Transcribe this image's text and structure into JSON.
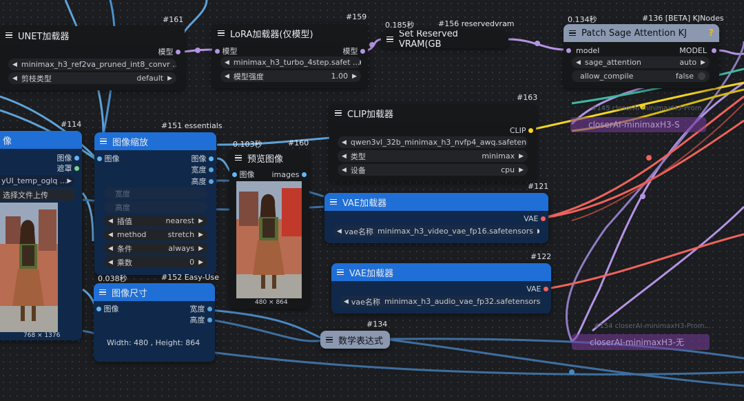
{
  "nodes": {
    "unet": {
      "id": "#161",
      "title": "UNET加载器",
      "out": "模型",
      "w1_value": "minimax_h3_ref2va_pruned_int8_convr ...",
      "w2_label": "剪枝类型",
      "w2_value": "default"
    },
    "lora": {
      "id": "#159",
      "title": "LoRA加载器(仅模型)",
      "in": "模型",
      "out": "模型",
      "w1_value": "minimax_h3_turbo_4step.safet ...",
      "w2_label": "模型强度",
      "w2_value": "1.00"
    },
    "vram": {
      "id": "#156 reservedvram",
      "time": "0.185秒",
      "title": "Set Reserved VRAM(GB"
    },
    "sage": {
      "id": "#136 [BETA] KJNodes",
      "time": "0.134秒",
      "title": "Patch Sage Attention KJ",
      "help": "?",
      "in": "model",
      "out": "MODEL",
      "w1_label": "sage_attention",
      "w1_value": "auto",
      "w2_label": "allow_compile",
      "w2_value": "false"
    },
    "clip": {
      "id": "#163",
      "title": "CLIP加载器",
      "out": "CLIP",
      "w1_value": "qwen3vl_32b_minimax_h3_nvfp4_awq.safeten ...",
      "w2_label": "类型",
      "w2_value": "minimax",
      "w3_label": "设备",
      "w3_value": "cpu"
    },
    "loadimg": {
      "id": "#114",
      "title": "像",
      "out1": "图像",
      "out2": "遮罩",
      "w1_value": "yUI_temp_oglq ...",
      "upload": "选择文件上传",
      "dims": "768 × 1376"
    },
    "scale": {
      "id": "#151 essentials",
      "title": "图像缩放",
      "in": "图像",
      "out1": "图像",
      "out2": "宽度",
      "out3": "高度",
      "p1": "宽度",
      "p2": "高度",
      "w1_label": "插值",
      "w1_value": "nearest",
      "w2_label": "method",
      "w2_value": "stretch",
      "w3_label": "条件",
      "w3_value": "always",
      "w4_label": "乘数",
      "w4_value": "0"
    },
    "preview": {
      "id": "#160",
      "time": "0.103秒",
      "title": "预览图像",
      "in": "图像",
      "out": "images",
      "dims": "480 × 864"
    },
    "vae1": {
      "id": "#121",
      "title": "VAE加载器",
      "out": "VAE",
      "w_label": "vae名称",
      "w_value": "minimax_h3_video_vae_fp16.safetensors"
    },
    "vae2": {
      "id": "#122",
      "title": "VAE加载器",
      "out": "VAE",
      "w_label": "vae名称",
      "w_value": "minimax_h3_audio_vae_fp32.safetensors"
    },
    "imgsize": {
      "id": "#152 Easy-Use",
      "time": "0.038秒",
      "title": "图像尺寸",
      "in": "图像",
      "out1": "宽度",
      "out2": "高度",
      "info": "Width: 480 , Height: 864"
    },
    "math": {
      "id": "#134",
      "title": "数学表达式"
    }
  },
  "groups": {
    "g1_label": "closerAI-minimaxH3-S",
    "g1_faint": "#145 closerAI-minimaxH3-Prom",
    "g2_label": "closerAI-minimaxH3-无",
    "g2_faint": "#154 closerAI-minimaxH3-Prom..."
  },
  "colors": {
    "model": "#b494e4",
    "clip": "#f5d422",
    "vae": "#f0635c",
    "image": "#64b5f6",
    "int": "#5fa3d8"
  }
}
